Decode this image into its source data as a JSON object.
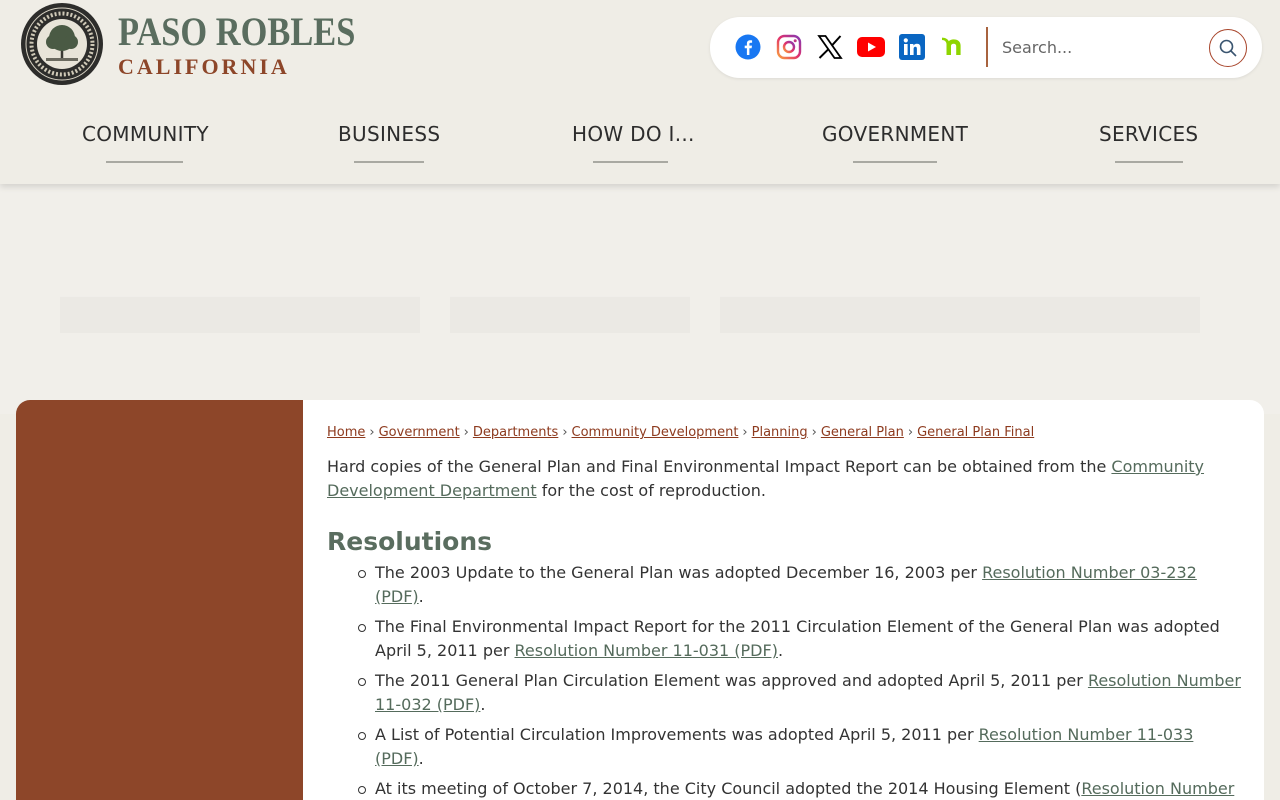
{
  "logo": {
    "seal_text": "CITY OF EL PASO DE ROBLES",
    "line1": "PASO ROBLES",
    "line2": "CALIFORNIA"
  },
  "social": [
    {
      "name": "facebook",
      "color": "#1877f2"
    },
    {
      "name": "instagram",
      "color": "#e1306c"
    },
    {
      "name": "x",
      "color": "#000000"
    },
    {
      "name": "youtube",
      "color": "#ff0000"
    },
    {
      "name": "linkedin",
      "color": "#0a66c2"
    },
    {
      "name": "nextdoor",
      "color": "#8ed500"
    }
  ],
  "search": {
    "placeholder": "Search..."
  },
  "nav": {
    "community": "COMMUNITY",
    "business": "BUSINESS",
    "how_do_i": "HOW DO I...",
    "government": "GOVERNMENT",
    "services": "SERVICES"
  },
  "breadcrumb": {
    "home": "Home",
    "government": "Government",
    "departments": "Departments",
    "community_development": "Community Development",
    "planning": "Planning",
    "general_plan": "General Plan",
    "general_plan_final": "General Plan Final",
    "separator": "›"
  },
  "intro": {
    "text_before": "Hard copies of the General Plan and Final Environmental Impact Report can be obtained from the ",
    "link": "Community Development Department",
    "text_after": " for the cost of reproduction."
  },
  "resolutions": {
    "heading": "Resolutions",
    "items": [
      {
        "text": "The 2003 Update to the General Plan was adopted December 16, 2003 per ",
        "link": "Resolution Number 03-232 (PDF)",
        "after": "."
      },
      {
        "text": "The Final Environmental Impact Report for the 2011 Circulation Element of the General Plan was adopted April 5, 2011 per ",
        "link": "Resolution Number 11-031 (PDF)",
        "after": "."
      },
      {
        "text": "The 2011 General Plan Circulation Element was approved and adopted April 5, 2011 per ",
        "link": "Resolution Number 11-032 (PDF)",
        "after": "."
      },
      {
        "text": "A List of Potential Circulation Improvements was adopted April 5, 2011 per ",
        "link": "Resolution Number 11-033 (PDF)",
        "after": "."
      },
      {
        "text": "At its meeting of October 7, 2014, the City Council adopted the 2014 Housing Element (",
        "link": "Resolution Number",
        "after": ""
      }
    ]
  },
  "colors": {
    "brand_green": "#5a6d5f",
    "brand_rust": "#8d4629",
    "link_green": "#556b5c",
    "breadcrumb_link": "#8d3a1e"
  }
}
